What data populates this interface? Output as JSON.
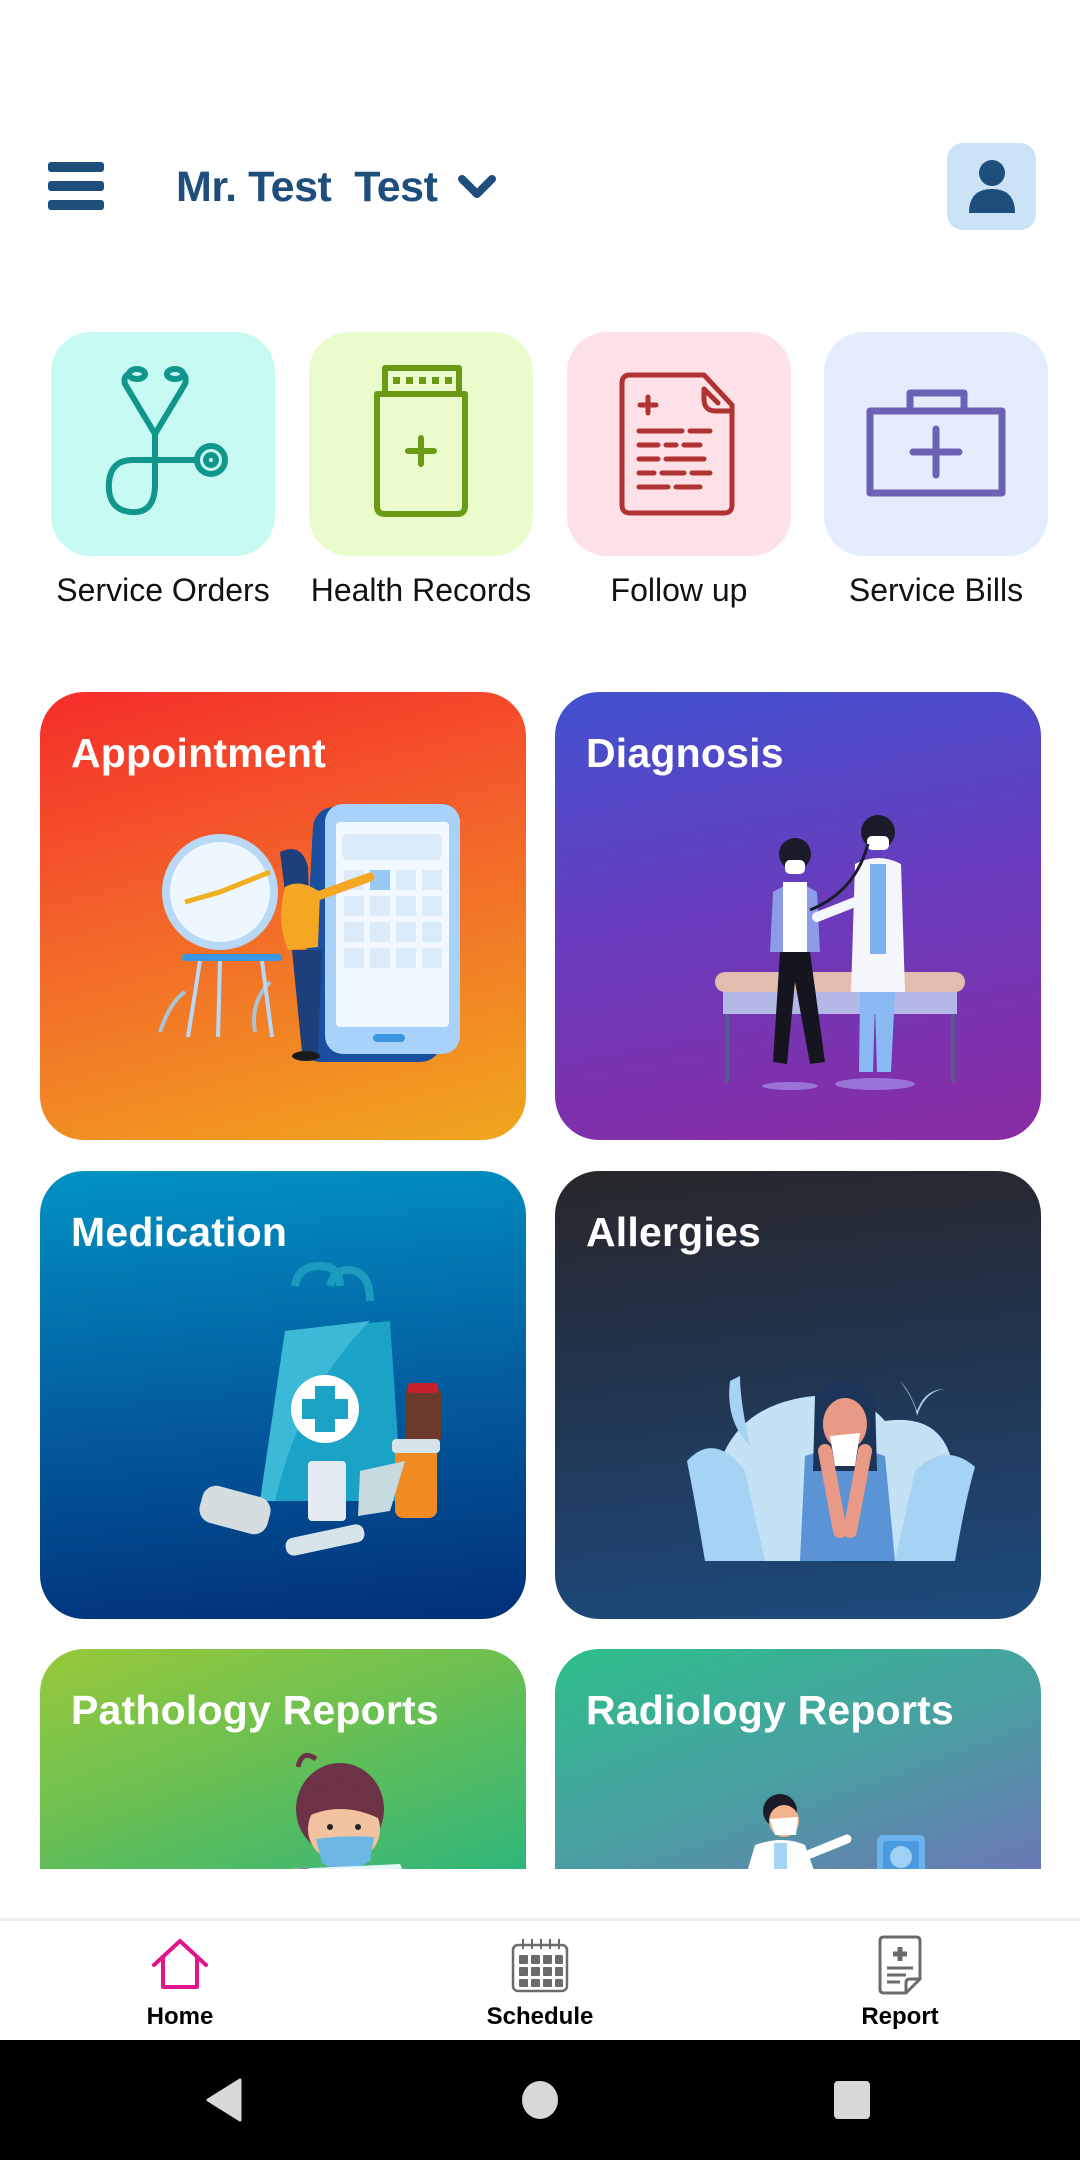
{
  "header": {
    "menu_icon": "hamburger-menu-icon",
    "user_name": "Mr. Test  Test",
    "dropdown_icon": "chevron-down-icon",
    "profile_icon": "user-icon",
    "colors": {
      "primary": "#1d4e7c",
      "avatar_bg": "#cbe2f7"
    }
  },
  "quick_actions": [
    {
      "label": "Service Orders",
      "icon": "stethoscope-icon",
      "bg": "#c8faf4",
      "fg": "#10968a"
    },
    {
      "label": "Health Records",
      "icon": "medicine-jar-icon",
      "bg": "#eafccb",
      "fg": "#6b9a16"
    },
    {
      "label": "Follow up",
      "icon": "medical-document-icon",
      "bg": "#fde1e6",
      "fg": "#b03232"
    },
    {
      "label": "Service Bills",
      "icon": "first-aid-kit-icon",
      "bg": "#e4ecfd",
      "fg": "#6a63b5"
    }
  ],
  "cards": [
    {
      "title": "Appointment",
      "illustration": "appointment-calendar-illustration",
      "gradient": [
        "#f52c2a",
        "#f0a71e"
      ]
    },
    {
      "title": "Diagnosis",
      "illustration": "doctor-patient-illustration",
      "gradient": [
        "#4151d0",
        "#8a2ba3"
      ]
    },
    {
      "title": "Medication",
      "illustration": "medicine-bag-illustration",
      "gradient": [
        "#0192c3",
        "#012f79"
      ]
    },
    {
      "title": "Allergies",
      "illustration": "sneezing-person-illustration",
      "gradient": [
        "#27272b",
        "#1d4b7e"
      ]
    },
    {
      "title": "Pathology Reports",
      "illustration": "lab-doctor-illustration",
      "gradient": [
        "#98c93a",
        "#2fb67b"
      ]
    },
    {
      "title": "Radiology Reports",
      "illustration": "radiologist-illustration",
      "gradient": [
        "#2dbf8b",
        "#6a78b4"
      ]
    }
  ],
  "bottom_nav": {
    "active_color": "#e0158b",
    "inactive_color": "#6b6b6b",
    "items": [
      {
        "label": "Home",
        "icon": "home-icon",
        "active": true
      },
      {
        "label": "Schedule",
        "icon": "calendar-icon",
        "active": false
      },
      {
        "label": "Report",
        "icon": "medical-report-icon",
        "active": false
      }
    ]
  },
  "system_nav": {
    "back": "back-icon",
    "home": "home-circle-icon",
    "recents": "recents-icon"
  }
}
